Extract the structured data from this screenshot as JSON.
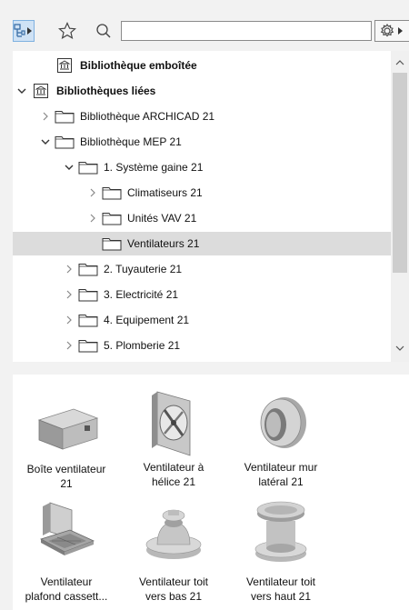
{
  "toolbar": {
    "tree_view_button": "tree-view-toggle",
    "favorites_button": "favorites",
    "search_button": "search",
    "search_value": "",
    "search_placeholder": "",
    "settings_button": "settings"
  },
  "tree": {
    "items": [
      {
        "label": "Bibliothèque emboîtée",
        "bold": true,
        "expander": "none"
      },
      {
        "label": "Bibliothèques liées",
        "bold": true,
        "expander": "expanded"
      },
      {
        "label": "Bibliothèque ARCHICAD 21",
        "bold": false,
        "expander": "collapsed"
      },
      {
        "label": "Bibliothèque MEP 21",
        "bold": false,
        "expander": "expanded"
      },
      {
        "label": "1. Système gaine 21",
        "bold": false,
        "expander": "expanded"
      },
      {
        "label": "Climatiseurs 21",
        "bold": false,
        "expander": "collapsed"
      },
      {
        "label": "Unités VAV 21",
        "bold": false,
        "expander": "collapsed"
      },
      {
        "label": "Ventilateurs 21",
        "bold": false,
        "expander": "none",
        "selected": true
      },
      {
        "label": "2. Tuyauterie 21",
        "bold": false,
        "expander": "collapsed"
      },
      {
        "label": "3. Electricité 21",
        "bold": false,
        "expander": "collapsed"
      },
      {
        "label": "4. Equipement 21",
        "bold": false,
        "expander": "collapsed"
      },
      {
        "label": "5. Plomberie 21",
        "bold": false,
        "expander": "collapsed"
      }
    ]
  },
  "preview": {
    "tiles": [
      {
        "line1": "Boîte ventilateur",
        "line2": "21",
        "icon": "fan-box-icon"
      },
      {
        "line1": "Ventilateur à",
        "line2": "hélice 21",
        "icon": "propeller-fan-icon"
      },
      {
        "line1": "Ventilateur mur",
        "line2": "latéral 21",
        "icon": "wall-fan-icon"
      },
      {
        "line1": "Ventilateur",
        "line2": "plafond cassett...",
        "icon": "ceiling-cassette-fan-icon"
      },
      {
        "line1": "Ventilateur toit",
        "line2": "vers bas 21",
        "icon": "roof-fan-down-icon"
      },
      {
        "line1": "Ventilateur toit",
        "line2": "vers haut 21",
        "icon": "roof-fan-up-icon"
      }
    ]
  },
  "colors": {
    "selection": "#dcdcdc",
    "active_button": "#cfe2f5",
    "panel": "#ffffff",
    "background": "#f2f2f2"
  }
}
